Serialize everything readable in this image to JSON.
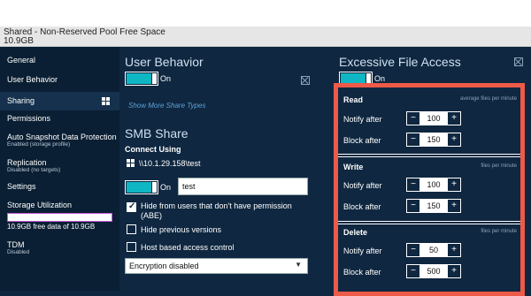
{
  "header": {
    "title": "Shared - Non-Reserved Pool Free Space",
    "subtitle": "10.9GB"
  },
  "sidebar": {
    "items": [
      {
        "label": "General"
      },
      {
        "label": "User Behavior"
      },
      {
        "label": "Sharing"
      },
      {
        "label": "Permissions"
      },
      {
        "label": "Auto Snapshot Data Protection",
        "sub": "Enabled (storage profile)"
      },
      {
        "label": "Replication",
        "sub": "Disabled (no targets)"
      },
      {
        "label": "Settings"
      },
      {
        "label": "Storage Utilization",
        "sub": "10.9GB free data of 10.9GB"
      },
      {
        "label": "TDM",
        "sub": "Disabled"
      }
    ]
  },
  "user_behavior": {
    "title": "User Behavior",
    "toggle_label": "On",
    "link": "Show More Share Types"
  },
  "smb": {
    "title": "SMB Share",
    "connect_heading": "Connect Using",
    "path": "\\\\10.1.29.158\\test",
    "toggle_label": "On",
    "share_name": "test",
    "options": [
      {
        "label": "Hide from users that don't have permission",
        "label2": "(ABE)",
        "checked": true
      },
      {
        "label": "Hide previous versions",
        "checked": false
      },
      {
        "label": "Host based access control",
        "checked": false
      }
    ],
    "encryption": "Encryption disabled"
  },
  "efa": {
    "title": "Excessive File Access",
    "toggle_label": "On",
    "groups": [
      {
        "title": "Read",
        "hint": "average files per minute",
        "rows": [
          {
            "label": "Notify after",
            "value": "100"
          },
          {
            "label": "Block after",
            "value": "150"
          }
        ]
      },
      {
        "title": "Write",
        "hint": "files per minute",
        "rows": [
          {
            "label": "Notify after",
            "value": "100"
          },
          {
            "label": "Block after",
            "value": "150"
          }
        ]
      },
      {
        "title": "Delete",
        "hint": "files per minute",
        "rows": [
          {
            "label": "Notify after",
            "value": "50"
          },
          {
            "label": "Block after",
            "value": "500"
          }
        ]
      }
    ],
    "minus_label": "−",
    "plus_label": "+"
  },
  "colors": {
    "accent": "#0fb6c4",
    "highlight": "#ee5a48",
    "background": "#0f2740"
  }
}
